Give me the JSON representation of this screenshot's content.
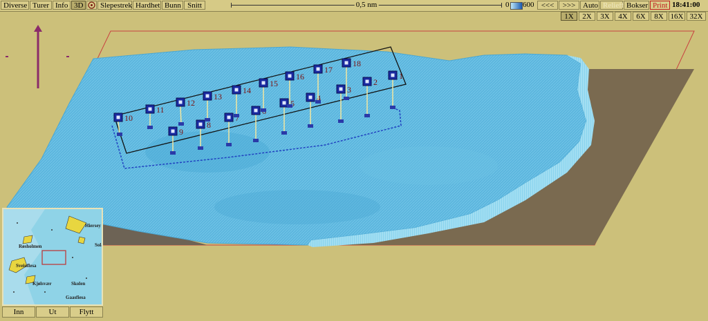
{
  "toolbar": {
    "menu": [
      "Diverse",
      "Turer",
      "Info",
      "3D"
    ],
    "menu2": [
      "Slepestrek",
      "Hardhet",
      "Bunn",
      "Snitt"
    ],
    "scale_label": "0,5 nm",
    "depth_min": "0",
    "depth_max": "600",
    "nav_back": "<<<",
    "nav_fwd": ">>>",
    "auto": "Auto",
    "relieff": "Relieff",
    "bokser": "Bokser",
    "print": "Print",
    "time": "18:41:00",
    "zoom": [
      "1X",
      "2X",
      "3X",
      "4X",
      "6X",
      "8X",
      "16X",
      "32X"
    ]
  },
  "markers": [
    "1",
    "2",
    "3",
    "4",
    "5",
    "6",
    "7",
    "8",
    "9",
    "10",
    "11",
    "12",
    "13",
    "14",
    "15",
    "16",
    "17",
    "18"
  ],
  "minimap": {
    "labels": [
      "Røsholmen",
      "Sveioflesa",
      "Kjølsvær",
      "Skolen",
      "Gaasfiesa",
      "Sola",
      "Hiersey"
    ],
    "buttons": [
      "Inn",
      "Ut",
      "Flytt"
    ]
  },
  "colors": {
    "background": "#ccc07a",
    "seabed": "#5ab4dc",
    "ground": "#7a6a52",
    "survey_box": "#111111",
    "marker": "#1a2aa0",
    "marker_label": "#7a1010",
    "boundary": "#d24040"
  }
}
